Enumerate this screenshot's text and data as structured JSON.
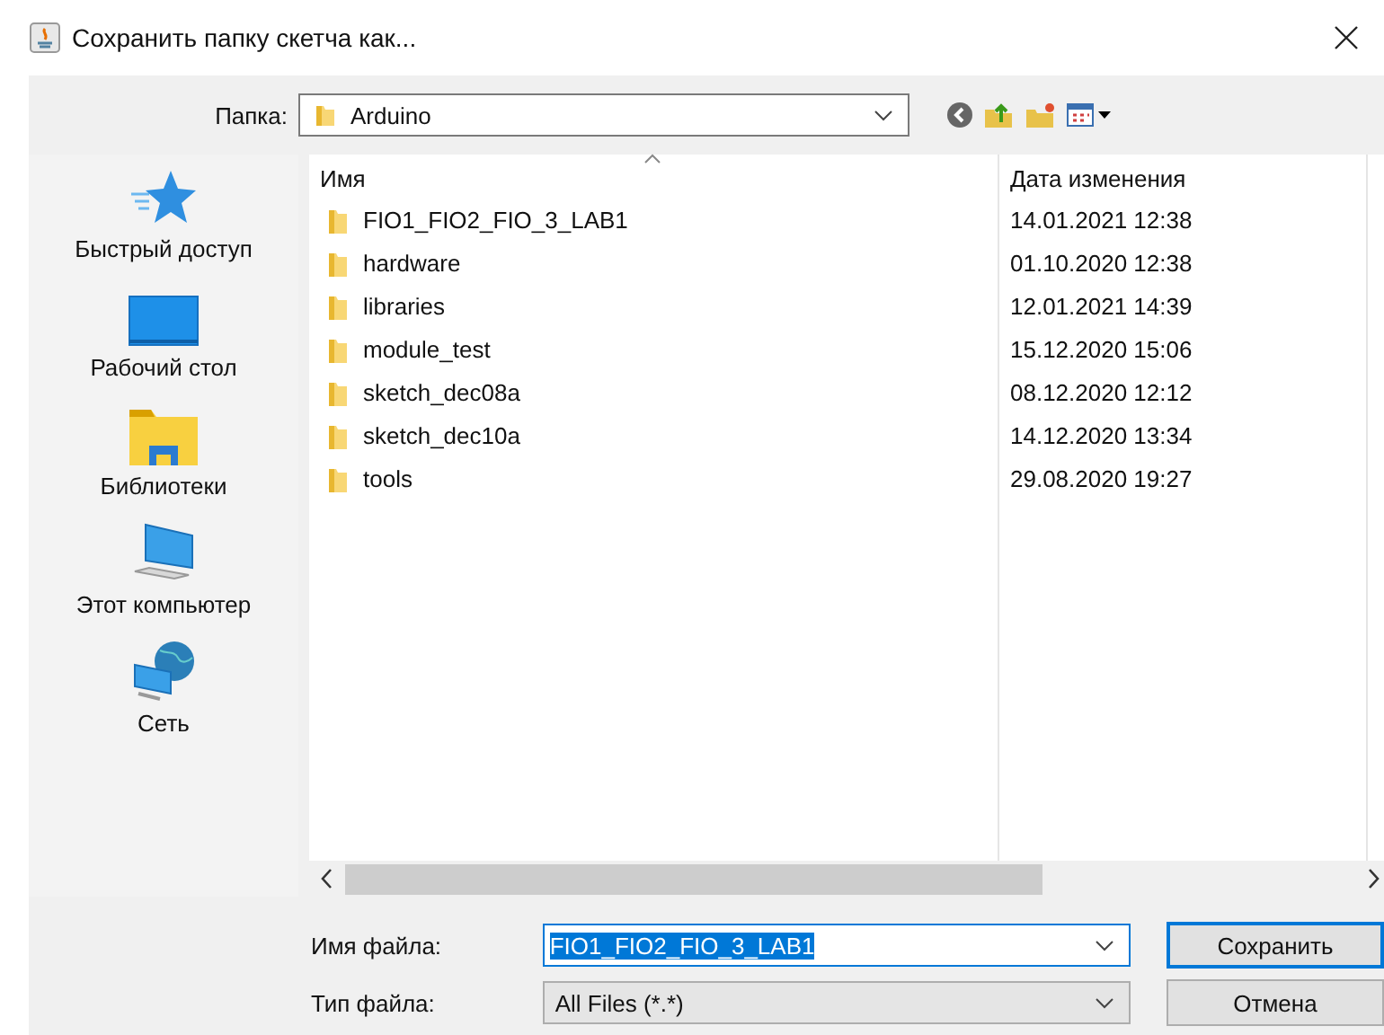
{
  "window": {
    "title": "Сохранить папку скетча как..."
  },
  "folder": {
    "label": "Папка:",
    "value": "Arduino"
  },
  "sidebar": {
    "items": [
      {
        "kind": "quick",
        "label": "Быстрый доступ"
      },
      {
        "kind": "desktop",
        "label": "Рабочий стол"
      },
      {
        "kind": "libraries",
        "label": "Библиотеки"
      },
      {
        "kind": "computer",
        "label": "Этот компьютер"
      },
      {
        "kind": "network",
        "label": "Сеть"
      }
    ]
  },
  "table": {
    "columns": [
      "Имя",
      "Дата изменения"
    ],
    "rows": [
      {
        "name": "FIO1_FIO2_FIO_3_LAB1",
        "date": "14.01.2021 12:38"
      },
      {
        "name": "hardware",
        "date": "01.10.2020 12:38"
      },
      {
        "name": "libraries",
        "date": "12.01.2021 14:39"
      },
      {
        "name": "module_test",
        "date": "15.12.2020 15:06"
      },
      {
        "name": "sketch_dec08a",
        "date": "08.12.2020 12:12"
      },
      {
        "name": "sketch_dec10a",
        "date": "14.12.2020 13:34"
      },
      {
        "name": "tools",
        "date": "29.08.2020 19:27"
      }
    ]
  },
  "file_name": {
    "label": "Имя файла:",
    "value": "FIO1_FIO2_FIO_3_LAB1"
  },
  "file_type": {
    "label": "Тип файла:",
    "value": "All Files (*.*)"
  },
  "buttons": [
    "Сохранить",
    "Отмена"
  ]
}
